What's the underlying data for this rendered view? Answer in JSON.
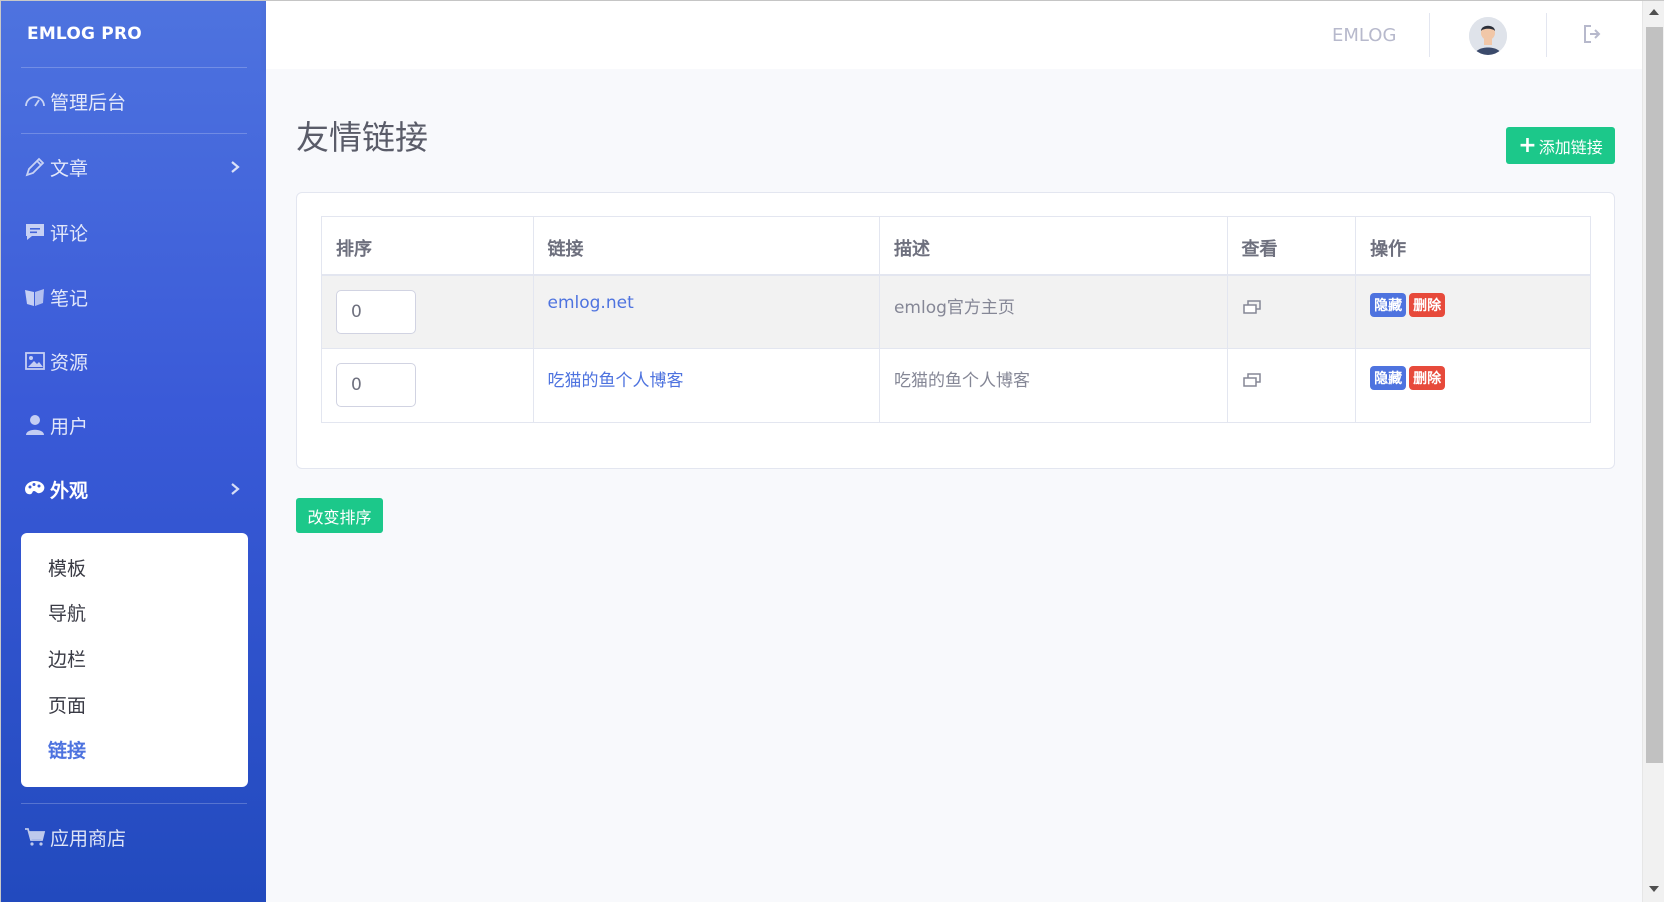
{
  "sidebar": {
    "brand": "EMLOG PRO",
    "items": [
      {
        "label": "管理后台",
        "icon": "dashboard-icon"
      },
      {
        "label": "文章",
        "icon": "pencil-icon"
      },
      {
        "label": "评论",
        "icon": "comment-icon"
      },
      {
        "label": "笔记",
        "icon": "note-icon"
      },
      {
        "label": "资源",
        "icon": "image-icon"
      },
      {
        "label": "用户",
        "icon": "user-icon"
      },
      {
        "label": "外观",
        "icon": "palette-icon"
      },
      {
        "label": "应用商店",
        "icon": "cart-icon"
      }
    ],
    "submenu": [
      "模板",
      "导航",
      "边栏",
      "页面",
      "链接"
    ]
  },
  "topbar": {
    "site_name": "EMLOG"
  },
  "main": {
    "title": "友情链接",
    "add_button": "添加链接",
    "sort_button": "改变排序",
    "table": {
      "headers": [
        "排序",
        "链接",
        "描述",
        "查看",
        "操作"
      ],
      "rows": [
        {
          "order": "0",
          "name": "emlog.net",
          "desc": "emlog官方主页",
          "hide": "隐藏",
          "delete": "删除"
        },
        {
          "order": "0",
          "name": "吃猫的鱼个人博客",
          "desc": "吃猫的鱼个人博客",
          "hide": "隐藏",
          "delete": "删除"
        }
      ]
    }
  },
  "colors": {
    "sidebar_gradient": [
      "#4e73df",
      "#224abe"
    ],
    "success": "#1cc88a",
    "primary": "#4e73df",
    "danger": "#e74a3b"
  }
}
